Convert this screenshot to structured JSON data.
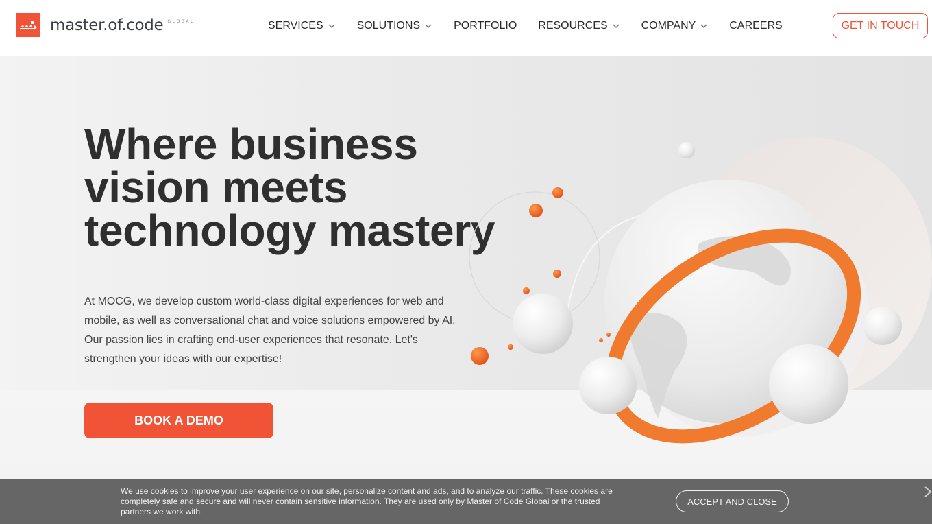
{
  "header": {
    "logo": {
      "text": "master.of.code",
      "subtext": "GLOBAL",
      "icon": "mocg-logo-icon"
    },
    "nav": [
      {
        "label": "SERVICES",
        "has_dropdown": true
      },
      {
        "label": "SOLUTIONS",
        "has_dropdown": true
      },
      {
        "label": "PORTFOLIO",
        "has_dropdown": false
      },
      {
        "label": "RESOURCES",
        "has_dropdown": true
      },
      {
        "label": "COMPANY",
        "has_dropdown": true
      },
      {
        "label": "CAREERS",
        "has_dropdown": false
      }
    ],
    "cta_label": "GET IN TOUCH"
  },
  "hero": {
    "title_lines": [
      "Where business",
      "vision meets",
      "technology mastery"
    ],
    "description": "At MOCG, we develop custom world-class digital experiences for web and mobile, as well as conversational chat and voice solutions empowered by AI. Our passion lies in crafting end-user experiences that resonate. Let's strengthen your ideas with our expertise!",
    "button_label": "BOOK A DEMO",
    "illustration": "globe-with-orange-ring-illustration"
  },
  "cookie_banner": {
    "text": "We use cookies to improve your user experience on our site, personalize content and ads, and to analyze our traffic. These cookies are completely safe and secure and will never contain sensitive information. They are used only by Master of Code Global or the trusted partners we work with.",
    "accept_label": "ACCEPT AND CLOSE",
    "close_icon": "close-icon"
  },
  "colors": {
    "brand": "#f05336",
    "text_dark": "#2f2f2f",
    "cookie_bg": "#666666",
    "ring_orange": "#f07a2e"
  }
}
